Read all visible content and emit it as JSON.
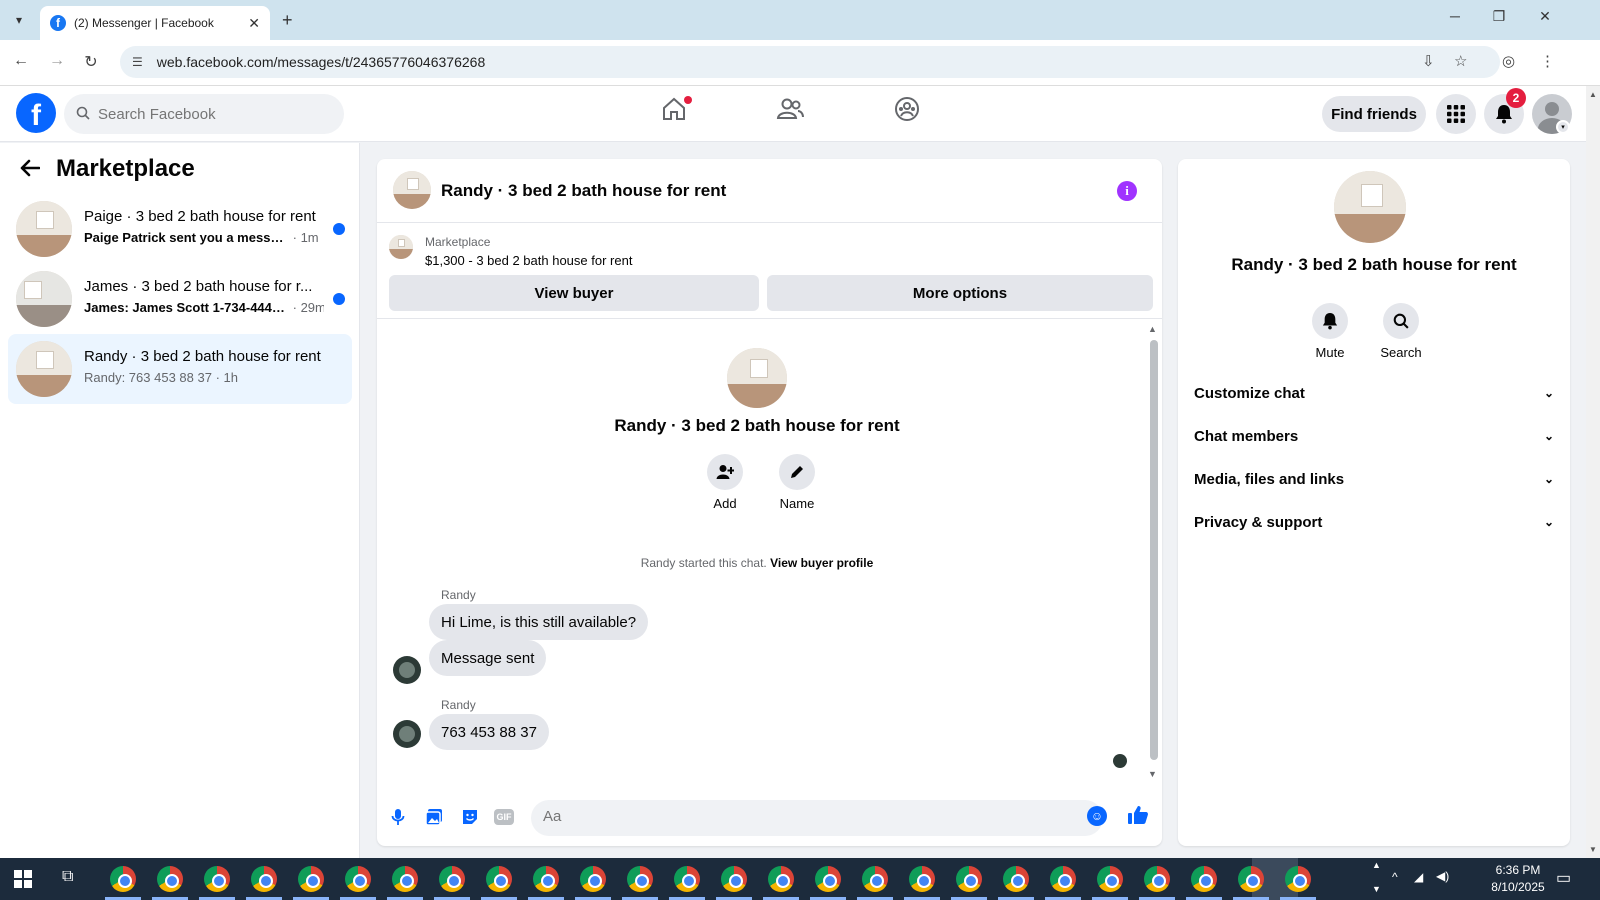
{
  "browser": {
    "tab_title": "(2) Messenger | Facebook",
    "url": "web.facebook.com/messages/t/24365776046376268"
  },
  "header": {
    "search_placeholder": "Search Facebook",
    "find_friends_label": "Find friends",
    "notification_count": "2",
    "colors": {
      "brand": "#0866ff",
      "badge": "#e41e3f"
    }
  },
  "sidebar": {
    "title": "Marketplace",
    "conversations": [
      {
        "name": "Paige · 3 bed 2 bath house for rent",
        "preview": "Paige Patrick sent you a message ...",
        "time": "· 1m",
        "unread": true
      },
      {
        "name": "James · 3 bed 2 bath house for r...",
        "preview": "James: James Scott 1-734-444-8...",
        "time": "· 29m",
        "unread": true
      },
      {
        "name": "Randy · 3 bed 2 bath house for rent",
        "preview": "Randy: 763 453 88 37",
        "time": "· 1h",
        "unread": false
      }
    ]
  },
  "chat": {
    "title": "Randy · 3 bed 2 bath house for rent",
    "listing_label": "Marketplace",
    "listing_price": "$1,300 - 3 bed 2 bath house for rent",
    "view_buyer_label": "View buyer",
    "more_options_label": "More options",
    "intro_name": "Randy · 3 bed 2 bath house for rent",
    "add_label": "Add",
    "name_label": "Name",
    "started_text": "Randy started this chat.",
    "view_buyer_profile": "View buyer profile",
    "messages": [
      {
        "sender": "Randy",
        "text": "Hi Lime, is this still available?"
      },
      {
        "sender": "",
        "text": "Message sent"
      },
      {
        "sender": "Randy",
        "text": "763 453 88 37"
      }
    ],
    "composer_placeholder": "Aa"
  },
  "info_panel": {
    "name": "Randy · 3 bed 2 bath house for rent",
    "mute_label": "Mute",
    "search_label": "Search",
    "sections": [
      "Customize chat",
      "Chat members",
      "Media, files and links",
      "Privacy & support"
    ]
  },
  "taskbar": {
    "time": "6:36 PM",
    "date": "8/10/2025"
  }
}
